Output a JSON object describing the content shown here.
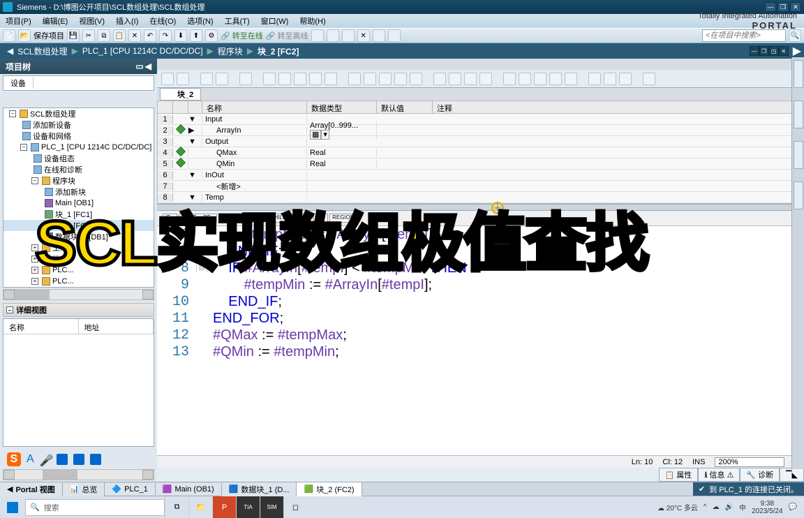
{
  "titlebar": {
    "app": "Siemens",
    "path": "D:\\博图公开项目\\SCL数组处理\\SCL数组处理"
  },
  "menu": {
    "items": [
      "项目(P)",
      "编辑(E)",
      "视图(V)",
      "插入(I)",
      "在线(O)",
      "选项(N)",
      "工具(T)",
      "窗口(W)",
      "帮助(H)"
    ],
    "brand_top": "Totally Integrated Automation",
    "brand_bot": "PORTAL"
  },
  "toolbar": {
    "save": "保存项目",
    "search_placeholder": "<在项目中搜索>",
    "go_online": "转至在线",
    "go_offline": "转至离线"
  },
  "breadcrumb": [
    "SCL数组处理",
    "PLC_1 [CPU 1214C DC/DC/DC]",
    "程序块",
    "块_2 [FC2]"
  ],
  "sidebar": {
    "header": "项目树",
    "tab": "设备",
    "tree": [
      {
        "lvl": 0,
        "tw": "-",
        "ico": "folder",
        "label": "SCL数组处理"
      },
      {
        "lvl": 1,
        "ico": "device",
        "label": "添加新设备"
      },
      {
        "lvl": 1,
        "ico": "device",
        "label": "设备和网络"
      },
      {
        "lvl": 1,
        "tw": "-",
        "ico": "device",
        "label": "PLC_1 [CPU 1214C DC/DC/DC]"
      },
      {
        "lvl": 2,
        "ico": "device",
        "label": "设备组态"
      },
      {
        "lvl": 2,
        "ico": "device",
        "label": "在线和诊断"
      },
      {
        "lvl": 2,
        "tw": "-",
        "ico": "folder",
        "label": "程序块"
      },
      {
        "lvl": 3,
        "ico": "device",
        "label": "添加新块"
      },
      {
        "lvl": 3,
        "ico": "purple",
        "label": "Main [OB1]"
      },
      {
        "lvl": 3,
        "ico": "green",
        "label": "块_1 [FC1]"
      },
      {
        "lvl": 3,
        "ico": "green",
        "label": "块_2 [FC2]",
        "sel": true
      },
      {
        "lvl": 3,
        "ico": "blue",
        "label": "数据块_1 [DB1]"
      },
      {
        "lvl": 2,
        "tw": "+",
        "ico": "folder",
        "label": "工..."
      },
      {
        "lvl": 2,
        "tw": "+",
        "ico": "folder",
        "label": "外..."
      },
      {
        "lvl": 2,
        "tw": "+",
        "ico": "folder",
        "label": "PLC..."
      },
      {
        "lvl": 2,
        "tw": "+",
        "ico": "folder",
        "label": "PLC..."
      }
    ],
    "detail_header": "详细视图",
    "detail_cols": [
      "名称",
      "地址"
    ]
  },
  "editor": {
    "block_title": "块_2",
    "var_headers": [
      "名称",
      "数据类型",
      "默认值",
      "注释"
    ],
    "var_rows": [
      {
        "n": "1",
        "exp": "▼",
        "name": "Input",
        "type": "",
        "def": ""
      },
      {
        "n": "2",
        "exp": "▶",
        "indent": 1,
        "dia": true,
        "name": "ArrayIn",
        "type": "Array[0..999...",
        "def": "",
        "dd": true
      },
      {
        "n": "3",
        "exp": "▼",
        "name": "Output",
        "type": "",
        "def": ""
      },
      {
        "n": "4",
        "indent": 1,
        "dia": true,
        "name": "QMax",
        "type": "Real",
        "def": ""
      },
      {
        "n": "5",
        "indent": 1,
        "dia": true,
        "name": "QMin",
        "type": "Real",
        "def": ""
      },
      {
        "n": "6",
        "exp": "▼",
        "name": "InOut",
        "type": "",
        "def": ""
      },
      {
        "n": "7",
        "indent": 1,
        "name": "<新增>",
        "type": "",
        "def": ""
      },
      {
        "n": "8",
        "exp": "▼",
        "name": "Temp",
        "type": "",
        "def": ""
      }
    ],
    "kw_blocks": [
      {
        "t": "IF..."
      },
      {
        "t": "CASE...\nOF..."
      },
      {
        "t": "FOR...\nTO DO..."
      },
      {
        "t": "WHILE...\nDO..."
      },
      {
        "t": "(*...*)"
      },
      {
        "t": "REGION"
      }
    ],
    "code": [
      {
        "n": 6,
        "txt": "        #tempMax := #ArrayIn[#tempI];"
      },
      {
        "n": 7,
        "txt": "    END_IF;"
      },
      {
        "n": 8,
        "fold": "⊟",
        "txt": "    IF #ArrayIn[#tempI] < #tempMin THEN"
      },
      {
        "n": 9,
        "txt": "        #tempMin := #ArrayIn[#tempI];"
      },
      {
        "n": 10,
        "txt": "    END_IF;"
      },
      {
        "n": 11,
        "txt": "END_FOR;"
      },
      {
        "n": 12,
        "txt": "#QMax := #tempMax;"
      },
      {
        "n": 13,
        "txt": "#QMin := #tempMin;"
      }
    ],
    "status": {
      "ln": "Ln: 10",
      "cl": "Cl: 12",
      "ins": "INS",
      "zoom": "200%"
    },
    "proptabs": [
      "属性",
      "信息",
      "诊断"
    ]
  },
  "viewtabs": {
    "portal": "Portal 视图",
    "tabs": [
      "总览",
      "PLC_1",
      "Main (OB1)",
      "数据块_1 (D...",
      "块_2 (FC2)"
    ],
    "status": "到 PLC_1 的连接已关闭。"
  },
  "taskbar": {
    "search": "搜索",
    "weather": "20°C 多云",
    "time": "9:38",
    "date": "2023/5/24"
  },
  "overlay": "SCL实现数组极值查找"
}
